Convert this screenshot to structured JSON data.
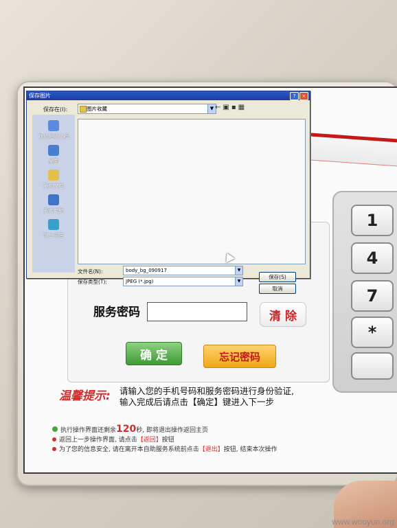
{
  "dialog": {
    "title": "保存图片",
    "help_btn": "?",
    "close_btn": "×",
    "save_in_label": "保存在(I):",
    "save_in_value": "图片收藏",
    "places": [
      {
        "label": "我最近的文档"
      },
      {
        "label": "桌面"
      },
      {
        "label": "我的文档"
      },
      {
        "label": "我的电脑"
      },
      {
        "label": "网上邻居"
      }
    ],
    "filename_label": "文件名(N):",
    "filename_value": "body_bg_090917",
    "filetype_label": "保存类型(T):",
    "filetype_value": "JPEG (*.jpg)",
    "save_button": "保存(S)",
    "cancel_button": "取消"
  },
  "kiosk": {
    "service_password_label": "服务密码",
    "clear_button": "清 除",
    "confirm_button": "确 定",
    "forgot_button": "忘记密码",
    "keypad": [
      "1",
      "4",
      "7",
      "*"
    ],
    "tip_title": "温馨提示:",
    "tip_line1": "请输入您的手机号码和服务密码进行身份验证,",
    "tip_line2": "输入完成后请点击【确定】键进入下一步",
    "notes": {
      "line1_prefix": "执行操作界面还剩余",
      "line1_count": "120",
      "line1_suffix": "秒, 即将退出操作返回主页",
      "line2_prefix": "返回上一步操作界面, 请点击",
      "line2_link": "【返回】",
      "line2_suffix": "按钮",
      "line3_prefix": "为了您的信息安全, 请在离开本自助服务系统前点击",
      "line3_link": "【退出】",
      "line3_suffix": "按钮, 结束本次操作"
    }
  },
  "watermark": "www.wooyun.org"
}
